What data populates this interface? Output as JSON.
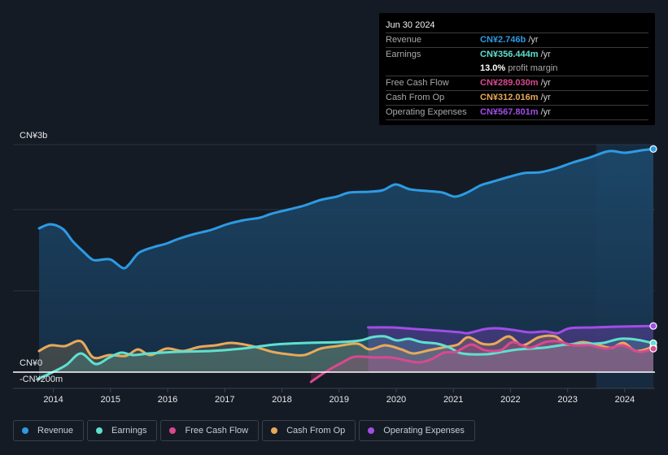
{
  "tooltip": {
    "date": "Jun 30 2024",
    "rows": [
      {
        "label": "Revenue",
        "value": "CN¥2.746b",
        "unit": " /yr",
        "color": "#2d9be3"
      },
      {
        "label": "Earnings",
        "value": "CN¥356.444m",
        "unit": " /yr",
        "color": "#5fe0cf"
      },
      {
        "label": "",
        "value": "13.0%",
        "unit": " profit margin",
        "color": "#ffffff"
      },
      {
        "label": "Free Cash Flow",
        "value": "CN¥289.030m",
        "unit": " /yr",
        "color": "#d9498f"
      },
      {
        "label": "Cash From Op",
        "value": "CN¥312.016m",
        "unit": " /yr",
        "color": "#e8a95a"
      },
      {
        "label": "Operating Expenses",
        "value": "CN¥567.801m",
        "unit": " /yr",
        "color": "#a24de6"
      }
    ]
  },
  "legend": [
    {
      "label": "Revenue",
      "color": "#2d9be3"
    },
    {
      "label": "Earnings",
      "color": "#5fe0cf"
    },
    {
      "label": "Free Cash Flow",
      "color": "#d9498f"
    },
    {
      "label": "Cash From Op",
      "color": "#e8a95a"
    },
    {
      "label": "Operating Expenses",
      "color": "#a24de6"
    }
  ],
  "chart_data": {
    "type": "area",
    "title": "",
    "xlabel": "",
    "ylabel": "",
    "units": "CN¥ millions",
    "y_axis_labels": [
      "CN¥3b",
      "CN¥0",
      "-CN¥200m"
    ],
    "ylim": [
      -200,
      2800
    ],
    "xlim": [
      2013.75,
      2024.5
    ],
    "x_ticks": [
      "2014",
      "2015",
      "2016",
      "2017",
      "2018",
      "2019",
      "2020",
      "2021",
      "2022",
      "2023",
      "2024"
    ],
    "grid": true,
    "legend_position": "bottom",
    "highlight_period": [
      2023.5,
      2024.5
    ],
    "series": [
      {
        "name": "Revenue",
        "color": "#2d9be3",
        "x": [
          2013.75,
          2013.95,
          2014.17,
          2014.34,
          2014.53,
          2014.7,
          2014.91,
          2015.02,
          2015.22,
          2015.33,
          2015.5,
          2015.76,
          2015.97,
          2016.19,
          2016.47,
          2016.76,
          2017.04,
          2017.33,
          2017.61,
          2017.82,
          2018.11,
          2018.39,
          2018.68,
          2018.96,
          2019.18,
          2019.53,
          2019.77,
          2019.99,
          2020.24,
          2020.53,
          2020.81,
          2021.03,
          2021.24,
          2021.48,
          2021.67,
          2021.96,
          2022.24,
          2022.52,
          2022.81,
          2023.09,
          2023.38,
          2023.66,
          2023.8,
          2024.01,
          2024.3,
          2024.5
        ],
        "values": [
          1770,
          1820,
          1760,
          1610,
          1480,
          1380,
          1390,
          1380,
          1280,
          1330,
          1470,
          1540,
          1580,
          1640,
          1700,
          1750,
          1820,
          1870,
          1900,
          1950,
          2000,
          2050,
          2120,
          2160,
          2210,
          2220,
          2240,
          2310,
          2250,
          2230,
          2210,
          2160,
          2210,
          2300,
          2340,
          2400,
          2450,
          2460,
          2510,
          2580,
          2640,
          2710,
          2720,
          2700,
          2730,
          2746
        ]
      },
      {
        "name": "Earnings",
        "color": "#5fe0cf",
        "x": [
          2013.75,
          2013.99,
          2014.23,
          2014.48,
          2014.74,
          2014.98,
          2015.19,
          2015.4,
          2015.68,
          2016.18,
          2016.75,
          2017.31,
          2017.88,
          2018.45,
          2019.02,
          2019.37,
          2019.58,
          2019.8,
          2020.01,
          2020.22,
          2020.44,
          2020.72,
          2020.94,
          2021.15,
          2021.57,
          2021.86,
          2022.14,
          2022.57,
          2022.99,
          2023.42,
          2023.63,
          2023.92,
          2024.2,
          2024.5
        ],
        "values": [
          -80,
          0,
          90,
          230,
          100,
          180,
          240,
          210,
          230,
          250,
          260,
          290,
          340,
          360,
          370,
          390,
          430,
          440,
          390,
          410,
          370,
          350,
          300,
          230,
          220,
          250,
          280,
          300,
          340,
          350,
          360,
          410,
          400,
          356
        ]
      },
      {
        "name": "Free Cash Flow",
        "color": "#d9498f",
        "x": [
          2018.51,
          2018.78,
          2019.06,
          2019.28,
          2019.63,
          2019.91,
          2020.2,
          2020.41,
          2020.62,
          2020.84,
          2021.05,
          2021.31,
          2021.55,
          2021.83,
          2022.04,
          2022.33,
          2022.61,
          2022.82,
          2023.11,
          2023.39,
          2023.68,
          2023.96,
          2024.25,
          2024.5
        ],
        "values": [
          -120,
          10,
          120,
          190,
          180,
          180,
          140,
          120,
          160,
          240,
          250,
          340,
          270,
          270,
          370,
          300,
          370,
          380,
          330,
          330,
          290,
          330,
          250,
          289
        ]
      },
      {
        "name": "Cash From Op",
        "color": "#e8a95a",
        "x": [
          2013.75,
          2013.95,
          2014.2,
          2014.48,
          2014.7,
          2014.98,
          2015.27,
          2015.48,
          2015.7,
          2015.98,
          2016.27,
          2016.55,
          2016.84,
          2017.12,
          2017.48,
          2017.83,
          2018.11,
          2018.39,
          2018.68,
          2018.96,
          2019.32,
          2019.53,
          2019.81,
          2020.09,
          2020.3,
          2020.58,
          2020.87,
          2021.08,
          2021.26,
          2021.5,
          2021.72,
          2021.97,
          2022.21,
          2022.5,
          2022.78,
          2022.99,
          2023.27,
          2023.55,
          2023.77,
          2023.98,
          2024.2,
          2024.5
        ],
        "values": [
          260,
          330,
          320,
          380,
          180,
          210,
          200,
          280,
          210,
          290,
          260,
          310,
          330,
          360,
          320,
          250,
          220,
          210,
          290,
          320,
          350,
          280,
          330,
          280,
          230,
          270,
          310,
          340,
          430,
          350,
          350,
          440,
          330,
          430,
          440,
          340,
          370,
          330,
          300,
          360,
          260,
          312
        ]
      },
      {
        "name": "Operating Expenses",
        "color": "#a24de6",
        "x": [
          2019.51,
          2019.91,
          2020.34,
          2020.76,
          2021.12,
          2021.26,
          2021.55,
          2021.76,
          2022.04,
          2022.33,
          2022.61,
          2022.82,
          2023.04,
          2023.46,
          2023.89,
          2024.5
        ],
        "values": [
          550,
          550,
          530,
          510,
          490,
          480,
          530,
          540,
          520,
          490,
          500,
          480,
          540,
          550,
          560,
          568
        ]
      }
    ]
  }
}
